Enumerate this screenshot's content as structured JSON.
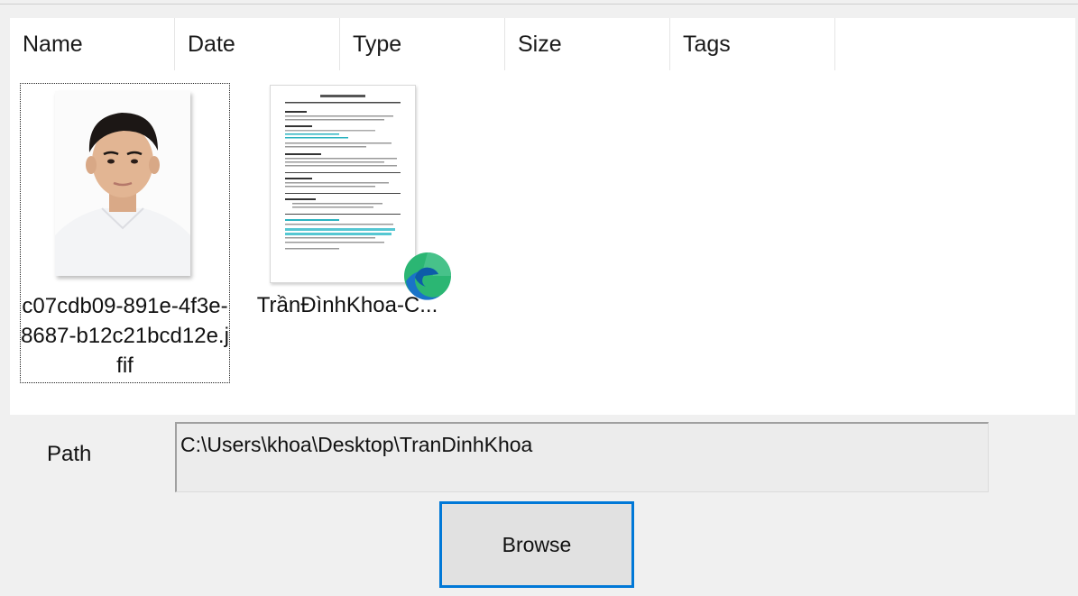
{
  "columns": [
    {
      "label": "Name"
    },
    {
      "label": "Date"
    },
    {
      "label": "Type"
    },
    {
      "label": "Size"
    },
    {
      "label": "Tags"
    }
  ],
  "files": [
    {
      "name": "c07cdb09-891e-4f3e-8687-b12c21bcd12e.jfif",
      "icon": "photo-thumbnail"
    },
    {
      "name": "TrầnĐìnhKhoa-C...",
      "icon": "pdf-document-thumbnail",
      "badge_icon": "edge-icon"
    }
  ],
  "path": {
    "label": "Path",
    "value": "C:\\Users\\khoa\\Desktop\\TranDinhKhoa"
  },
  "browse_button": {
    "label": "Browse"
  },
  "colors": {
    "accent": "#0078d7",
    "window_background": "#f0f0f0",
    "list_background": "#ffffff",
    "button_face": "#e1e1e1"
  }
}
